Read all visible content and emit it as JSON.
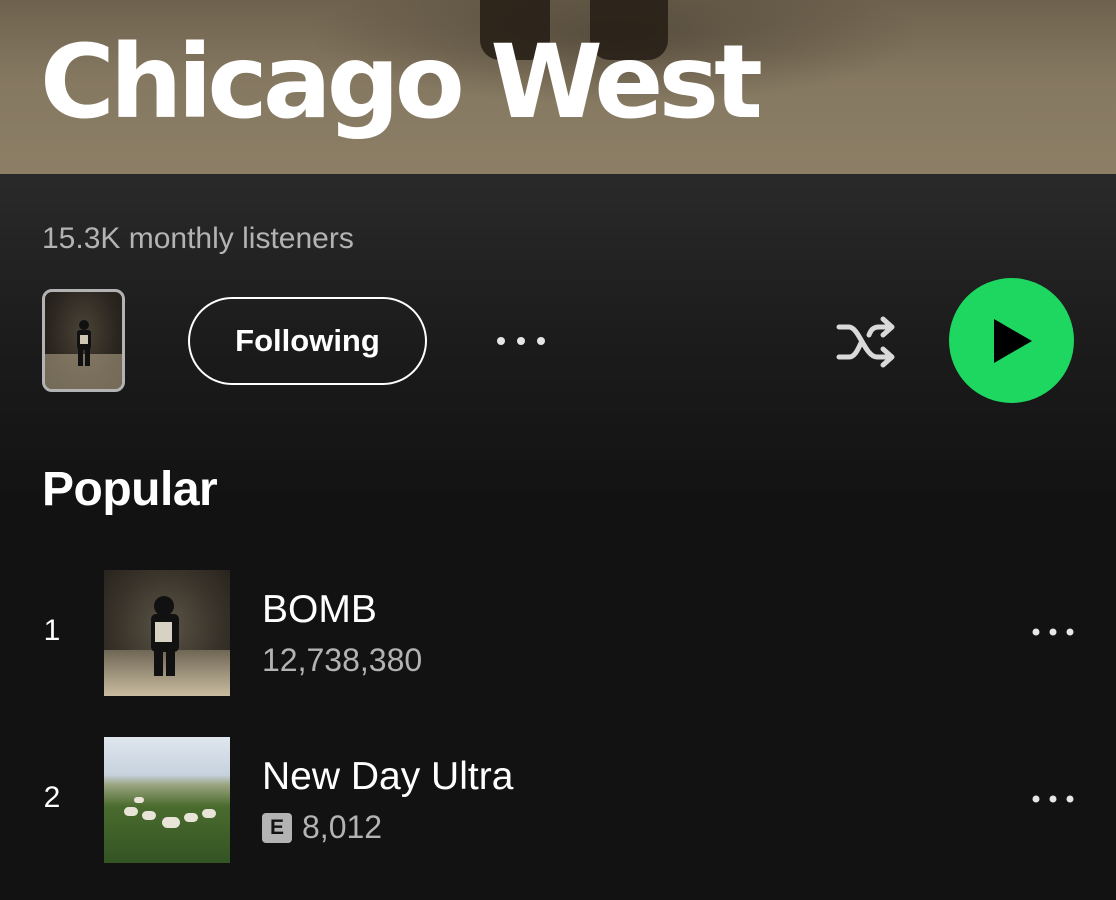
{
  "artist": {
    "name": "Chicago West",
    "monthly_listeners": "15.3K monthly listeners"
  },
  "controls": {
    "follow_label": "Following",
    "more_icon": "more-horizontal-icon",
    "shuffle_icon": "shuffle-icon",
    "play_icon": "play-icon",
    "accent_color": "#1ed760"
  },
  "popular": {
    "title": "Popular",
    "tracks": [
      {
        "number": "1",
        "title": "BOMB",
        "plays": "12,738,380",
        "explicit": false
      },
      {
        "number": "2",
        "title": "New Day Ultra",
        "plays": "8,012",
        "explicit": true,
        "explicit_label": "E"
      }
    ]
  }
}
